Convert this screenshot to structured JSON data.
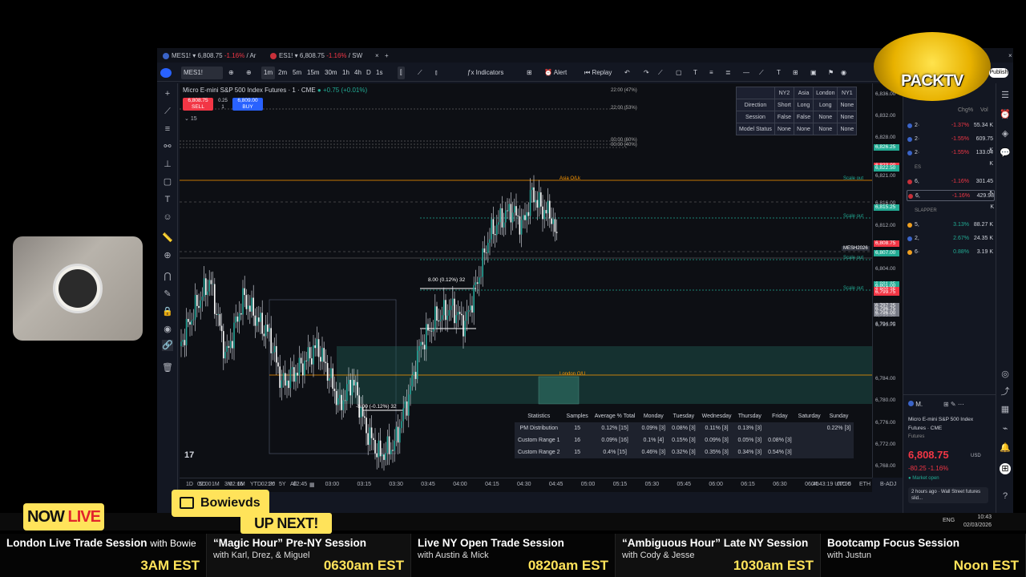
{
  "browser": {
    "tabs": [
      {
        "label": "MES1!",
        "price": "6,808.75",
        "change": "-1.16%",
        "extra": "/ Ar"
      },
      {
        "label": "ES1!",
        "price": "6,808.75",
        "change": "-1.16%",
        "extra": "/ SW"
      }
    ]
  },
  "toolbar": {
    "symbol": "MES1!",
    "intervals": [
      "1m",
      "2m",
      "5m",
      "15m",
      "30m",
      "1h",
      "4h",
      "D",
      "1s"
    ],
    "active_interval": "1m",
    "indicators_label": "Indicators",
    "alert_label": "Alert",
    "replay_label": "Replay",
    "publish_label": "Publish"
  },
  "chart": {
    "title": "Micro E-mini S&P 500 Index Futures · 1 · CME",
    "change": "+0.75 (+0.01%)",
    "sell_price": "6,808.75",
    "sell_label": "SELL",
    "spread": "0.25",
    "qty": "1",
    "buy_price": "6,809.00",
    "buy_label": "BUY",
    "count": "15",
    "top_labels": [
      "22:00 (47%)",
      "22:00 (53%)",
      "00:00 (60%)",
      "00:00 (40%)"
    ],
    "scale_out": [
      "Scale out",
      "Scale out",
      "Scale out",
      "Scale out"
    ],
    "asia_label": "Asia O/Lk",
    "london_label": "London O/U",
    "box_label_top": "8.00 (0.12%) 32",
    "box_label_bottom": "-8.00 (-0.12%) 32",
    "symbol_badge": "MESH2026",
    "timezone": "04:43:19 UTC-5",
    "eth": "ETH",
    "badj": "B-ADJ"
  },
  "session_table": {
    "headers": [
      "",
      "NY2",
      "Asia",
      "London",
      "NY1"
    ],
    "rows": [
      [
        "Direction",
        "Short",
        "Long",
        "Long",
        "None"
      ],
      [
        "Session",
        "False",
        "False",
        "None",
        "None"
      ],
      [
        "Model Status",
        "None",
        "None",
        "None",
        "None"
      ]
    ]
  },
  "stats_table": {
    "headers": [
      "Statistics",
      "Samples",
      "Average % Total",
      "Monday",
      "Tuesday",
      "Wednesday",
      "Thursday",
      "Friday",
      "Saturday",
      "Sunday"
    ],
    "rows": [
      [
        "PM Distribution",
        "15",
        "0.12% [15]",
        "0.09% [3]",
        "0.08% [3]",
        "0.11% [3]",
        "0.13% [3]",
        "",
        "",
        "0.22% [3]"
      ],
      [
        "Custom Range 1",
        "16",
        "0.09% [16]",
        "0.1% [4]",
        "0.15% [3]",
        "0.09% [3]",
        "0.05% [3]",
        "0.08% [3]",
        "",
        ""
      ],
      [
        "Custom Range 2",
        "15",
        "0.4% [15]",
        "0.46% [3]",
        "0.32% [3]",
        "0.35% [3]",
        "0.34% [3]",
        "0.54% [3]",
        "",
        ""
      ]
    ]
  },
  "price_axis": [
    "6,836.00",
    "6,832.00",
    "6,828.00",
    "6,826.25",
    "6,823.00",
    "6,822.50",
    "6,821.00",
    "6,816.00",
    "6,815.25",
    "6,812.00",
    "6,808.75",
    "6,807.00",
    "6,804.00",
    "6,801.25",
    "6,801.00",
    "6,800.25",
    "6,799.75",
    "6,797.25",
    "6,796.75",
    "6,796.00",
    "6,795.50",
    "6,794.00",
    "6,793.75",
    "6,784.00",
    "6,780.00",
    "6,776.00",
    "6,772.00",
    "6,768.00"
  ],
  "time_axis": [
    "02:00",
    "02:15",
    "02:30",
    "02:45",
    "03:00",
    "03:15",
    "03:30",
    "03:45",
    "04:00",
    "04:15",
    "04:30",
    "04:45",
    "05:00",
    "05:15",
    "05:30",
    "05:45",
    "06:00",
    "06:15",
    "06:30",
    "06:45",
    "07:00"
  ],
  "range_buttons": [
    "1D",
    "5D",
    "1M",
    "3M",
    "6M",
    "YTD",
    "1Y",
    "5Y",
    "All"
  ],
  "watchlist": {
    "headers": [
      "Chg%",
      "Vol"
    ],
    "rows": [
      {
        "sym": "2·",
        "chg": "-1.37%",
        "vol": "55.34 K"
      },
      {
        "sym": "2·",
        "chg": "-1.55%",
        "vol": "609.75 K"
      },
      {
        "sym": "2·",
        "chg": "-1.55%",
        "vol": "133.04 K"
      }
    ],
    "group1": "ES",
    "group1_rows": [
      {
        "sym": "6,",
        "chg": "-1.16%",
        "vol": "301.45 K"
      },
      {
        "sym": "6,",
        "chg": "-1.16%",
        "vol": "429.98 K"
      }
    ],
    "group2": "SLAPPER",
    "group2_rows": [
      {
        "sym": "5,",
        "chg": "3.13%",
        "vol": "88.27 K"
      },
      {
        "sym": "2,",
        "chg": "2.67%",
        "vol": "24.35 K"
      },
      {
        "sym": "6·",
        "chg": "0.88%",
        "vol": "3.19 K"
      }
    ]
  },
  "details": {
    "symbol": "M.",
    "name": "Micro E-mini S&P 500 Index Futures · CME",
    "type": "Futures",
    "price": "6,808.75",
    "currency": "USD",
    "change": "-80.25 -1.16%",
    "status": "Market open",
    "news": "2 hours ago · Wall Street futures slid..."
  },
  "overlay": {
    "now": "NOW",
    "live": "LIVE",
    "up_next": "UP NEXT!",
    "streamer": "Bowievds",
    "logo": "PACKTV"
  },
  "system": {
    "lang": "ENG",
    "time": "10:43",
    "date": "02/03/2026"
  },
  "schedule": [
    {
      "title": "London Live Trade Session",
      "with": "with Bowie",
      "hosts": "",
      "time": "3AM EST"
    },
    {
      "title": "“Magic Hour” Pre-NY Session",
      "with": "",
      "hosts": "with Karl, Drez, & Miguel",
      "time": "0630am EST"
    },
    {
      "title": "Live NY Open Trade Session",
      "with": "",
      "hosts": "with Austin & Mick",
      "time": "0820am EST"
    },
    {
      "title": "“Ambiguous Hour” Late NY Session",
      "with": "",
      "hosts": "with Cody & Jesse",
      "time": "1030am EST"
    },
    {
      "title": "Bootcamp Focus Session",
      "with": "",
      "hosts": "with Justun",
      "time": "Noon EST"
    }
  ],
  "colors": {
    "bg": "#0d0f14",
    "up": "#22ab94",
    "down": "#f23645",
    "accent": "#ffe35a",
    "zone": "#1f5c52"
  }
}
